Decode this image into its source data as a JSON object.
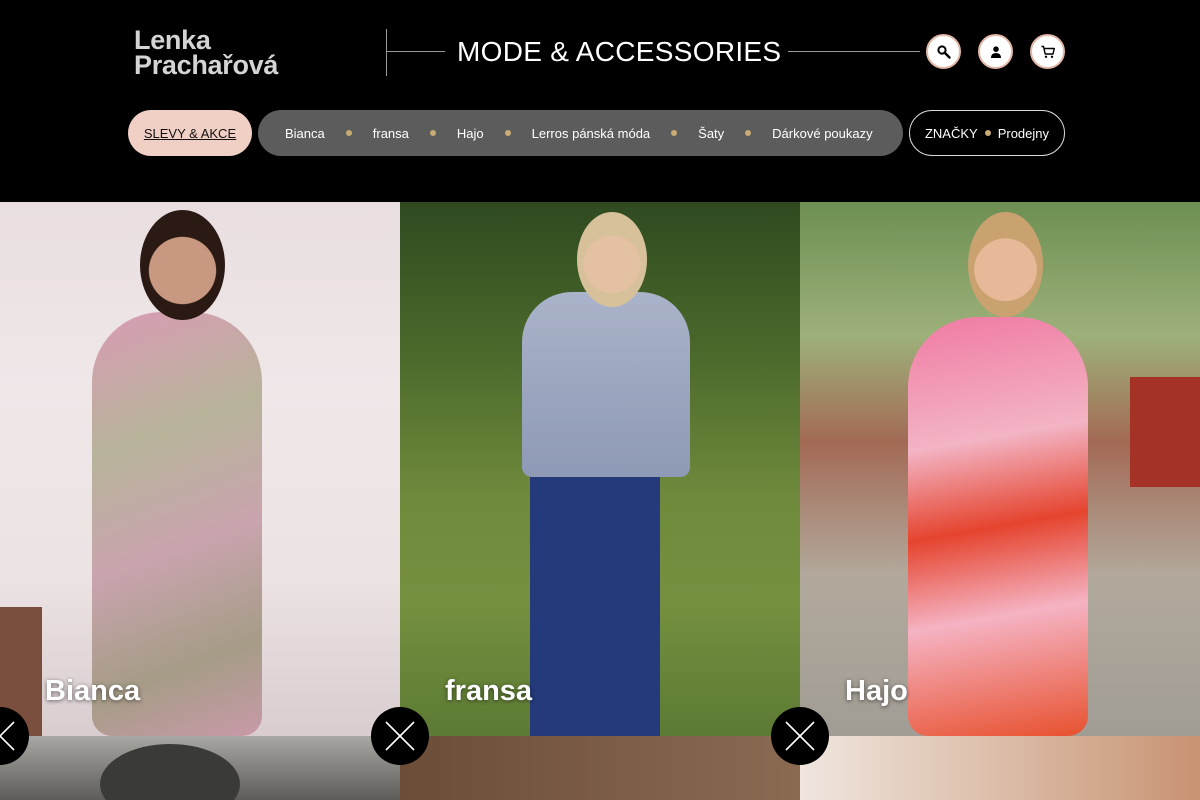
{
  "header": {
    "logo_line1": "Lenka",
    "logo_line2": "Prachařová",
    "tagline": "MODE & ACCESSORIES",
    "icons": [
      "search-icon",
      "user-icon",
      "cart-icon"
    ]
  },
  "nav": {
    "sale_label": "SLEVY & AKCE",
    "brands": [
      "Bianca",
      "fransa",
      "Hajo",
      "Lerros pánská móda",
      "Šaty",
      "Dárkové poukazy"
    ],
    "brands_label": "ZNAČKY",
    "stores_label": "Prodejny"
  },
  "cards": [
    {
      "label": "Bianca"
    },
    {
      "label": "fransa"
    },
    {
      "label": "Hajo"
    }
  ],
  "colors": {
    "background": "#000000",
    "sale_pill": "#f0cfc4",
    "brand_pill": "#5c5c5c",
    "dot": "#c7ad73",
    "icon_border": "#e3b7a7"
  }
}
